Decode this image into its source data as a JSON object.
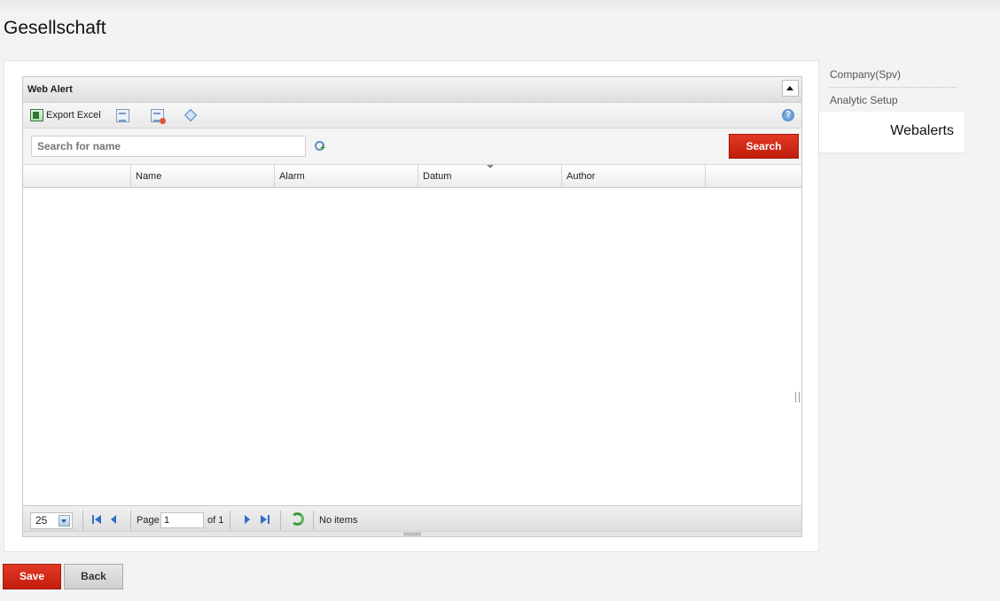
{
  "page": {
    "title": "Gesellschaft"
  },
  "grid": {
    "title": "Web Alert",
    "toolbar": {
      "export_label": "Export Excel"
    },
    "search": {
      "placeholder": "Search for name",
      "value": "Search for name",
      "button_label": "Search"
    },
    "columns": [
      "",
      "Name",
      "Alarm",
      "Datum",
      "Author",
      ""
    ],
    "rows": [],
    "pager": {
      "page_size": "25",
      "page_label": "Page",
      "current_page": "1",
      "of_label": "of 1",
      "status": "No items"
    }
  },
  "sidebar": {
    "items": [
      {
        "label": "Company(Spv)"
      },
      {
        "label": "Analytic Setup"
      },
      {
        "label": "Webalerts",
        "active": true
      }
    ]
  },
  "actions": {
    "save_label": "Save",
    "back_label": "Back"
  },
  "colors": {
    "accent_red": "#c91f0f",
    "panel_bg": "#ffffff",
    "page_bg": "#f3f3f3"
  }
}
